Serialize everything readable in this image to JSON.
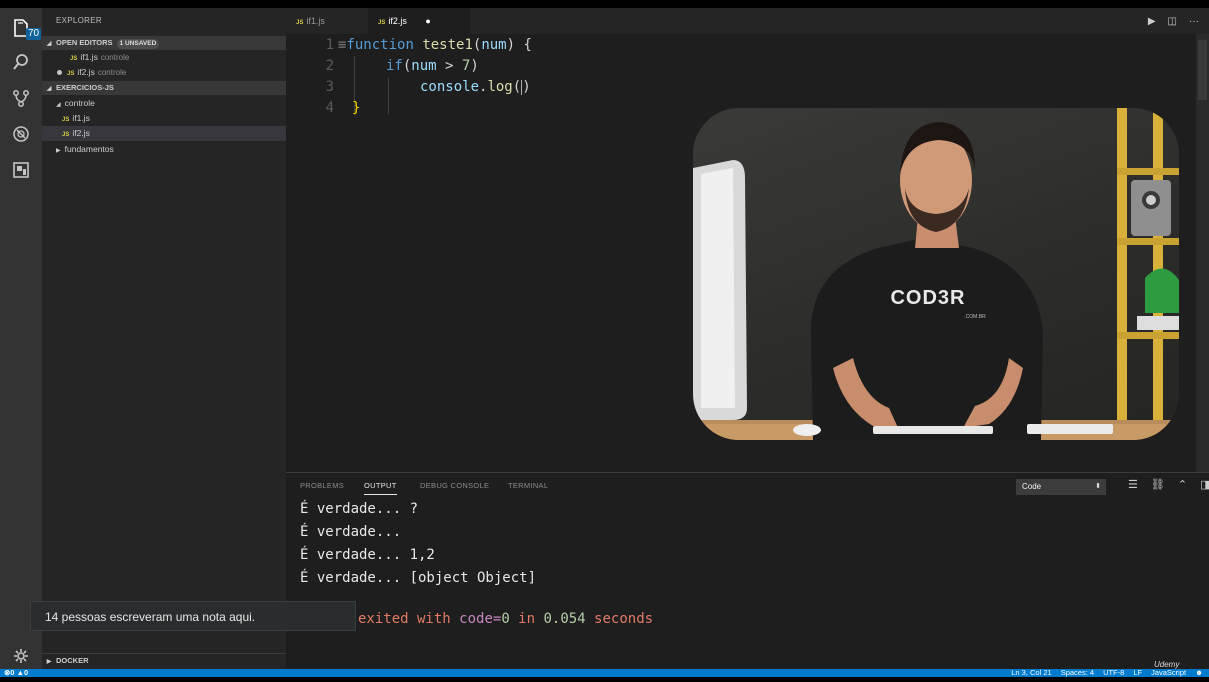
{
  "activity_bar": {
    "badge": "70",
    "icons": [
      "files-icon",
      "search-icon",
      "source-control-icon",
      "debug-icon",
      "extensions-icon",
      "settings-icon"
    ]
  },
  "sidebar": {
    "title": "EXPLORER",
    "open_editors": {
      "label": "OPEN EDITORS",
      "badge": "1 UNSAVED",
      "items": [
        {
          "name": "if1.js",
          "folder": "controle"
        },
        {
          "name": "if2.js",
          "folder": "controle"
        }
      ]
    },
    "workspace": {
      "label": "EXERCICIOS-JS",
      "items": [
        {
          "name": "controle"
        },
        {
          "name": "if1.js"
        },
        {
          "name": "if2.js"
        },
        {
          "name": "fundamentos"
        }
      ]
    },
    "docker": {
      "label": "DOCKER"
    }
  },
  "tabs": [
    {
      "label": "if1.js",
      "file_type": "JS"
    },
    {
      "label": "if2.js",
      "file_type": "JS"
    }
  ],
  "tab_file_type_label": "JS",
  "editor": {
    "line_numbers": [
      "1",
      "2",
      "3",
      "4"
    ],
    "code": {
      "l1_kw": "function",
      "l1_fn": "teste1",
      "l1_param": "num",
      "l2_kw": "if",
      "l2_param": "num",
      "l2_num": "7",
      "l3_obj": "console",
      "l3_fn": "log"
    }
  },
  "panel": {
    "tabs": [
      "PROBLEMS",
      "OUTPUT",
      "DEBUG CONSOLE",
      "TERMINAL"
    ],
    "active_tab": "OUTPUT",
    "channel": "Code",
    "output_lines": [
      "É verdade... ?",
      "É verdade...",
      "É verdade... 1,2",
      "É verdade... [object Object]"
    ],
    "exit_text": {
      "pre": "exited with ",
      "key": "code=",
      "code": "0",
      "mid": " in ",
      "time": "0.054",
      "post": " seconds"
    }
  },
  "toast": "14 pessoas escreveram uma nota aqui.",
  "status_bar": {
    "errors": "0",
    "warnings": "0",
    "position": "Ln 3, Col 21",
    "spaces": "Spaces: 4",
    "encoding": "UTF-8",
    "eol": "LF",
    "language": "JavaScript"
  },
  "watermark": "Udemy",
  "video": {
    "shirt_text": "COD3R",
    "shirt_subtext": ".COM.BR"
  },
  "colors": {
    "statusbar": "#007acc",
    "keyword": "#569cd6",
    "function": "#dcdcaa",
    "param": "#9cdcfe",
    "accent_exit": "#e27b66"
  }
}
